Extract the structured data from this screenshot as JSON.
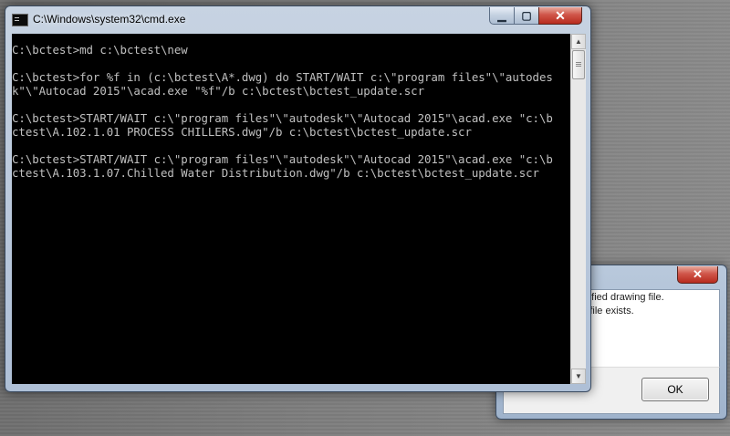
{
  "dialog": {
    "close_glyph": "✕",
    "message": "pecified drawing file.\nthe file exists.",
    "ok_label": "OK"
  },
  "window": {
    "title": "C:\\Windows\\system32\\cmd.exe",
    "min_glyph": "▁",
    "max_glyph": "▢",
    "close_glyph": "✕"
  },
  "console": {
    "text": "C:\\bctest>md c:\\bctest\\new\n\nC:\\bctest>for %f in (c:\\bctest\\A*.dwg) do START/WAIT c:\\\"program files\"\\\"autodes\nk\"\\\"Autocad 2015\"\\acad.exe \"%f\"/b c:\\bctest\\bctest_update.scr\n\nC:\\bctest>START/WAIT c:\\\"program files\"\\\"autodesk\"\\\"Autocad 2015\"\\acad.exe \"c:\\b\nctest\\A.102.1.01 PROCESS CHILLERS.dwg\"/b c:\\bctest\\bctest_update.scr\n\nC:\\bctest>START/WAIT c:\\\"program files\"\\\"autodesk\"\\\"Autocad 2015\"\\acad.exe \"c:\\b\nctest\\A.103.1.07.Chilled Water Distribution.dwg\"/b c:\\bctest\\bctest_update.scr"
  },
  "scrollbar": {
    "up_glyph": "▲",
    "down_glyph": "▼"
  }
}
